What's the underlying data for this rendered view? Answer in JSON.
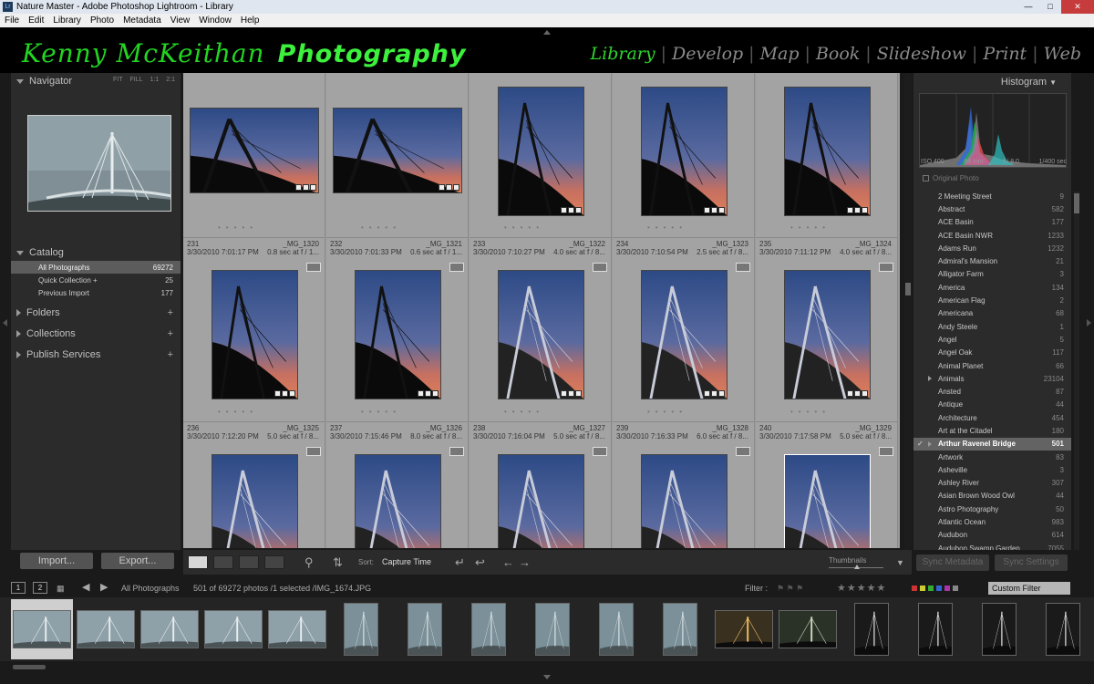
{
  "window": {
    "title": "Nature Master - Adobe Photoshop Lightroom - Library"
  },
  "menu": [
    "File",
    "Edit",
    "Library",
    "Photo",
    "Metadata",
    "View",
    "Window",
    "Help"
  ],
  "identity": {
    "name": "Kenny McKeithan",
    "tag": "Photography"
  },
  "modules": [
    "Library",
    "Develop",
    "Map",
    "Book",
    "Slideshow",
    "Print",
    "Web"
  ],
  "navigator": {
    "title": "Navigator",
    "zoom": [
      "FIT",
      "FILL",
      "1:1",
      "2:1"
    ]
  },
  "catalog": {
    "title": "Catalog",
    "items": [
      {
        "label": "All Photographs",
        "count": "69272"
      },
      {
        "label": "Quick Collection +",
        "count": "25"
      },
      {
        "label": "Previous Import",
        "count": "177"
      }
    ]
  },
  "panels": [
    {
      "label": "Folders"
    },
    {
      "label": "Collections"
    },
    {
      "label": "Publish Services"
    }
  ],
  "left_buttons": {
    "import": "Import...",
    "export": "Export..."
  },
  "grid": {
    "rows": [
      {
        "cells": [
          {
            "num": "",
            "name": "",
            "date": "",
            "exp": ""
          },
          {
            "num": "",
            "name": "",
            "date": "",
            "exp": ""
          },
          {
            "num": "",
            "name": "",
            "date": "",
            "exp": ""
          },
          {
            "num": "",
            "name": "",
            "date": "",
            "exp": ""
          },
          {
            "num": "",
            "name": "",
            "date": "",
            "exp": ""
          }
        ]
      },
      {
        "cells": [
          {
            "num": "231",
            "name": "_MG_1320",
            "date": "3/30/2010 7:01:17 PM",
            "exp": "0.8 sec at f / 1..."
          },
          {
            "num": "232",
            "name": "_MG_1321",
            "date": "3/30/2010 7:01:33 PM",
            "exp": "0.6 sec at f / 1..."
          },
          {
            "num": "233",
            "name": "_MG_1322",
            "date": "3/30/2010 7:10:27 PM",
            "exp": "4.0 sec at f / 8..."
          },
          {
            "num": "234",
            "name": "_MG_1323",
            "date": "3/30/2010 7:10:54 PM",
            "exp": "2.5 sec at f / 8..."
          },
          {
            "num": "235",
            "name": "_MG_1324",
            "date": "3/30/2010 7:11:12 PM",
            "exp": "4.0 sec at f / 8..."
          }
        ]
      },
      {
        "cells": [
          {
            "num": "236",
            "name": "_MG_1325",
            "date": "3/30/2010 7:12:20 PM",
            "exp": "5.0 sec at f / 8..."
          },
          {
            "num": "237",
            "name": "_MG_1326",
            "date": "3/30/2010 7:15:46 PM",
            "exp": "8.0 sec at f / 8..."
          },
          {
            "num": "238",
            "name": "_MG_1327",
            "date": "3/30/2010 7:16:04 PM",
            "exp": "5.0 sec at f / 8..."
          },
          {
            "num": "239",
            "name": "_MG_1328",
            "date": "3/30/2010 7:16:33 PM",
            "exp": "6.0 sec at f / 8..."
          },
          {
            "num": "240",
            "name": "_MG_1329",
            "date": "3/30/2010 7:17:58 PM",
            "exp": "5.0 sec at f / 8..."
          }
        ]
      }
    ]
  },
  "toolbar": {
    "sort_label": "Sort:",
    "sort_value": "Capture Time",
    "thumbnails": "Thumbnails"
  },
  "histogram": {
    "title": "Histogram",
    "iso": "ISO 400",
    "focal": "88 mm",
    "aperture": "f / 8.0",
    "shutter": "1/400 sec",
    "original": "Original Photo"
  },
  "keywords": [
    {
      "label": "2 Meeting Street",
      "count": "9"
    },
    {
      "label": "Abstract",
      "count": "582"
    },
    {
      "label": "ACE Basin",
      "count": "177"
    },
    {
      "label": "ACE Basin NWR",
      "count": "1233"
    },
    {
      "label": "Adams Run",
      "count": "1232"
    },
    {
      "label": "Admiral's Mansion",
      "count": "21"
    },
    {
      "label": "Alligator Farm",
      "count": "3"
    },
    {
      "label": "America",
      "count": "134"
    },
    {
      "label": "American Flag",
      "count": "2"
    },
    {
      "label": "Americana",
      "count": "68"
    },
    {
      "label": "Andy Steele",
      "count": "1"
    },
    {
      "label": "Angel",
      "count": "5"
    },
    {
      "label": "Angel Oak",
      "count": "117"
    },
    {
      "label": "Animal Planet",
      "count": "66"
    },
    {
      "label": "Animals",
      "count": "23104"
    },
    {
      "label": "Ansted",
      "count": "87"
    },
    {
      "label": "Antique",
      "count": "44"
    },
    {
      "label": "Architecture",
      "count": "454"
    },
    {
      "label": "Art at the Citadel",
      "count": "180"
    },
    {
      "label": "Arthur Ravenel Bridge",
      "count": "501"
    },
    {
      "label": "Artwork",
      "count": "83"
    },
    {
      "label": "Asheville",
      "count": "3"
    },
    {
      "label": "Ashley River",
      "count": "307"
    },
    {
      "label": "Asian Brown Wood Owl",
      "count": "44"
    },
    {
      "label": "Astro Photography",
      "count": "50"
    },
    {
      "label": "Atlantic Ocean",
      "count": "983"
    },
    {
      "label": "Audubon",
      "count": "614"
    },
    {
      "label": "Audubon Swamp Garden",
      "count": "7055"
    }
  ],
  "right_buttons": {
    "sync_metadata": "Sync Metadata",
    "sync_settings": "Sync Settings"
  },
  "filmstrip": {
    "page1": "1",
    "page2": "2",
    "source": "All Photographs",
    "status": "501 of 69272 photos /1 selected /IMG_1674.JPG",
    "filter_label": "Filter :",
    "custom_filter": "Custom Filter"
  },
  "colors": {
    "accent_green": "#23d423",
    "selection_gray": "#636363",
    "panel_bg": "#2b2b2b",
    "grid_bg": "#9b9b9b"
  }
}
